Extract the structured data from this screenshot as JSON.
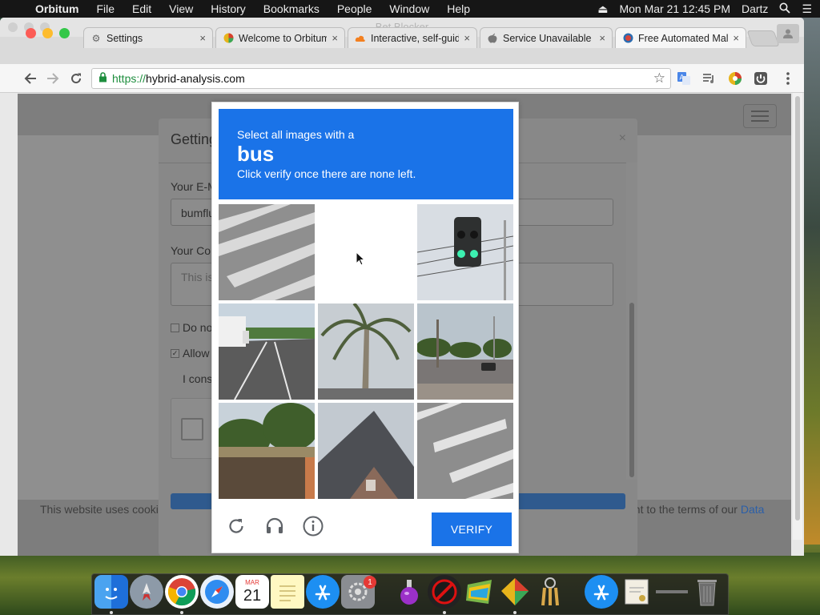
{
  "menubar": {
    "app_name": "Orbitum",
    "items": [
      "File",
      "Edit",
      "View",
      "History",
      "Bookmarks",
      "People",
      "Window",
      "Help"
    ],
    "clock": "Mon Mar 21  12:45 PM",
    "user": "Dartz"
  },
  "window": {
    "title": "Bet Blocker",
    "tabs": [
      {
        "title": "Settings",
        "icon": "gear-icon",
        "active": false
      },
      {
        "title": "Welcome to Orbitum",
        "icon": "orbitum-icon",
        "active": false
      },
      {
        "title": "Interactive, self-guid",
        "icon": "cloud-icon",
        "active": false
      },
      {
        "title": "Service Unavailable",
        "icon": "apple-icon",
        "active": false
      },
      {
        "title": "Free Automated Malw",
        "icon": "hybrid-analysis-icon",
        "active": true
      }
    ],
    "close_glyph": "×"
  },
  "toolbar": {
    "url_scheme": "https://",
    "url_host": "hybrid-analysis.com"
  },
  "modal": {
    "title": "Getting",
    "email_label": "Your E-M",
    "email_value": "bumflu",
    "comment_label": "Your Cor",
    "comment_placeholder": "This is",
    "check1": "Do no",
    "check2": "Allow",
    "consent_text": "I cons",
    "close_glyph": "×"
  },
  "cookie_banner": {
    "text": "This website uses cooki",
    "text_right": "ent to the terms of our",
    "link": "Data"
  },
  "captcha": {
    "instruction": "Select all images with a",
    "target": "bus",
    "hint": "Click verify once there are none left.",
    "verify_label": "VERIFY",
    "tiles": [
      {
        "subject": "crosswalk",
        "selected": false
      },
      {
        "subject": "blank",
        "selected": false
      },
      {
        "subject": "traffic light",
        "selected": false
      },
      {
        "subject": "truck on highway",
        "selected": false
      },
      {
        "subject": "palm tree",
        "selected": false
      },
      {
        "subject": "palm trees street with car",
        "selected": false
      },
      {
        "subject": "trees and building",
        "selected": false
      },
      {
        "subject": "house roof",
        "selected": false
      },
      {
        "subject": "crosswalk",
        "selected": false
      }
    ]
  },
  "dock": {
    "calendar_month": "MAR",
    "calendar_day": "21",
    "badge_count": "1"
  },
  "colors": {
    "accent": "#1a73e8",
    "menubar": "#161616",
    "secure_green": "#1e8e3e"
  }
}
